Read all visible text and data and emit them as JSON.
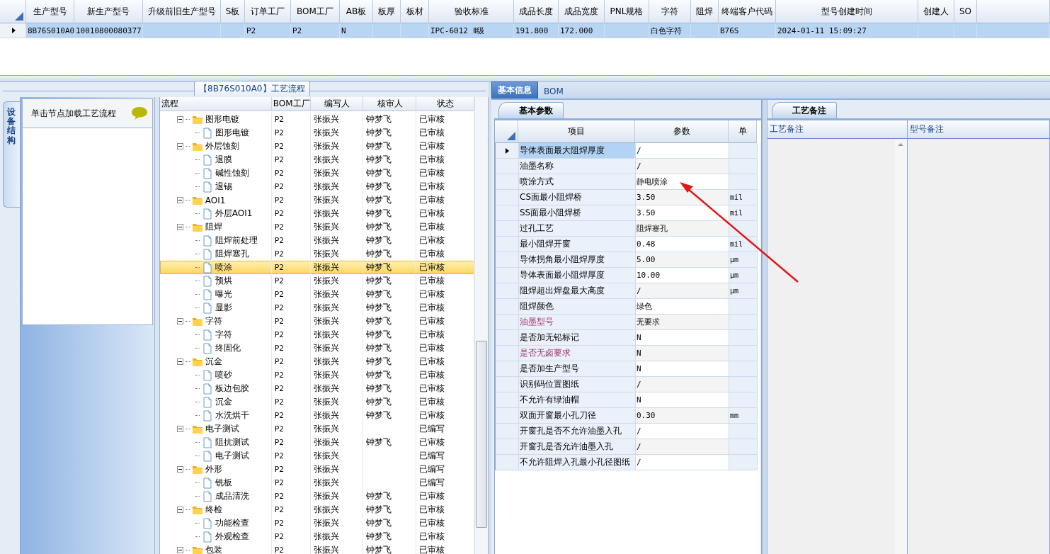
{
  "top_grid": {
    "columns": [
      "生产型号",
      "新生产型号",
      "升级前旧生产型号",
      "S板",
      "订单工厂",
      "BOM工厂",
      "AB板",
      "板厚",
      "板材",
      "验收标准",
      "成品长度",
      "成品宽度",
      "PNL规格",
      "字符",
      "阻焊",
      "终端客户代码",
      "型号创建时间",
      "创建人",
      "SO"
    ],
    "rows": [
      {
        "selected": true,
        "cells": [
          "8B76S010A0",
          "10010800080377",
          null,
          null,
          "P2",
          "P2",
          "N",
          null,
          null,
          "IPC-6012 Ⅱ级",
          "191.800",
          "172.000",
          null,
          "白色字符",
          null,
          "B76S",
          "2024-01-11 15:09:27",
          null,
          null
        ]
      }
    ]
  },
  "side_tab": {
    "label": "设备结构",
    "selected": true
  },
  "equipment_panel": {
    "hint": "单击节点加载工艺流程"
  },
  "process_group": {
    "title": "【8B76S010A0】工艺流程",
    "columns": [
      "流程",
      "BOM工厂",
      "编写人",
      "核审人",
      "状态"
    ],
    "tree": [
      {
        "name": "图形电镀",
        "factory": "P2",
        "writer": "张振兴",
        "reviewer": "钟梦飞",
        "status": "已审核",
        "selected": false,
        "expanded": true,
        "children": [
          {
            "name": "图形电镀",
            "factory": "P2",
            "writer": "张振兴",
            "reviewer": "钟梦飞",
            "status": "已审核",
            "selected": false
          }
        ]
      },
      {
        "name": "外层蚀刻",
        "factory": "P2",
        "writer": "张振兴",
        "reviewer": "钟梦飞",
        "status": "已审核",
        "selected": false,
        "expanded": true,
        "children": [
          {
            "name": "退膜",
            "factory": "P2",
            "writer": "张振兴",
            "reviewer": "钟梦飞",
            "status": "已审核",
            "selected": false
          },
          {
            "name": "碱性蚀刻",
            "factory": "P2",
            "writer": "张振兴",
            "reviewer": "钟梦飞",
            "status": "已审核",
            "selected": false
          },
          {
            "name": "退锡",
            "factory": "P2",
            "writer": "张振兴",
            "reviewer": "钟梦飞",
            "status": "已审核",
            "selected": false
          }
        ]
      },
      {
        "name": "AOI1",
        "factory": "P2",
        "writer": "张振兴",
        "reviewer": "钟梦飞",
        "status": "已审核",
        "selected": false,
        "expanded": true,
        "children": [
          {
            "name": "外层AOI1",
            "factory": "P2",
            "writer": "张振兴",
            "reviewer": "钟梦飞",
            "status": "已审核",
            "selected": false
          }
        ]
      },
      {
        "name": "阻焊",
        "factory": "P2",
        "writer": "张振兴",
        "reviewer": "钟梦飞",
        "status": "已审核",
        "selected": false,
        "expanded": true,
        "children": [
          {
            "name": "阻焊前处理",
            "factory": "P2",
            "writer": "张振兴",
            "reviewer": "钟梦飞",
            "status": "已审核",
            "selected": false
          },
          {
            "name": "阻焊塞孔",
            "factory": "P2",
            "writer": "张振兴",
            "reviewer": "钟梦飞",
            "status": "已审核",
            "selected": false
          },
          {
            "name": "喷涂",
            "factory": "P2",
            "writer": "张振兴",
            "reviewer": "钟梦飞",
            "status": "已审核",
            "selected": true
          },
          {
            "name": "预烘",
            "factory": "P2",
            "writer": "张振兴",
            "reviewer": "钟梦飞",
            "status": "已审核",
            "selected": false
          },
          {
            "name": "曝光",
            "factory": "P2",
            "writer": "张振兴",
            "reviewer": "钟梦飞",
            "status": "已审核",
            "selected": false
          },
          {
            "name": "显影",
            "factory": "P2",
            "writer": "张振兴",
            "reviewer": "钟梦飞",
            "status": "已审核",
            "selected": false
          }
        ]
      },
      {
        "name": "字符",
        "factory": "P2",
        "writer": "张振兴",
        "reviewer": "钟梦飞",
        "status": "已审核",
        "selected": false,
        "expanded": true,
        "children": [
          {
            "name": "字符",
            "factory": "P2",
            "writer": "张振兴",
            "reviewer": "钟梦飞",
            "status": "已审核",
            "selected": false
          },
          {
            "name": "终固化",
            "factory": "P2",
            "writer": "张振兴",
            "reviewer": "钟梦飞",
            "status": "已审核",
            "selected": false
          }
        ]
      },
      {
        "name": "沉金",
        "factory": "P2",
        "writer": "张振兴",
        "reviewer": "钟梦飞",
        "status": "已审核",
        "selected": false,
        "expanded": true,
        "children": [
          {
            "name": "喷砂",
            "factory": "P2",
            "writer": "张振兴",
            "reviewer": "钟梦飞",
            "status": "已审核",
            "selected": false
          },
          {
            "name": "板边包胶",
            "factory": "P2",
            "writer": "张振兴",
            "reviewer": "钟梦飞",
            "status": "已审核",
            "selected": false
          },
          {
            "name": "沉金",
            "factory": "P2",
            "writer": "张振兴",
            "reviewer": "钟梦飞",
            "status": "已审核",
            "selected": false
          },
          {
            "name": "水洗烘干",
            "factory": "P2",
            "writer": "张振兴",
            "reviewer": "钟梦飞",
            "status": "已审核",
            "selected": false
          }
        ]
      },
      {
        "name": "电子测试",
        "factory": "P2",
        "writer": "张振兴",
        "status": "已编写",
        "selected": false,
        "expanded": true,
        "children": [
          {
            "name": "阻抗测试",
            "factory": "P2",
            "writer": "张振兴",
            "reviewer": "钟梦飞",
            "status": "已审核",
            "selected": false
          },
          {
            "name": "电子测试",
            "factory": "P2",
            "writer": "张振兴",
            "status": "已编写",
            "selected": false
          }
        ]
      },
      {
        "name": "外形",
        "factory": "P2",
        "writer": "张振兴",
        "status": "已编写",
        "selected": false,
        "expanded": true,
        "children": [
          {
            "name": "铣板",
            "factory": "P2",
            "writer": "张振兴",
            "status": "已编写",
            "selected": false
          },
          {
            "name": "成品清洗",
            "factory": "P2",
            "writer": "张振兴",
            "reviewer": "钟梦飞",
            "status": "已审核",
            "selected": false
          }
        ]
      },
      {
        "name": "终检",
        "factory": "P2",
        "writer": "张振兴",
        "reviewer": "钟梦飞",
        "status": "已审核",
        "selected": false,
        "expanded": true,
        "children": [
          {
            "name": "功能检查",
            "factory": "P2",
            "writer": "张振兴",
            "reviewer": "钟梦飞",
            "status": "已审核",
            "selected": false
          },
          {
            "name": "外观检查",
            "factory": "P2",
            "writer": "张振兴",
            "reviewer": "钟梦飞",
            "status": "已审核",
            "selected": false
          }
        ]
      },
      {
        "name": "包装",
        "factory": "P2",
        "writer": "张振兴",
        "reviewer": "钟梦飞",
        "status": "已审核",
        "selected": false,
        "expanded": true
      }
    ]
  },
  "detail_tabs": [
    {
      "label": "基本信息",
      "selected": true
    },
    {
      "label": "BOM",
      "selected": false
    }
  ],
  "param_tab": {
    "label": "基本参数",
    "selected": true
  },
  "param_grid": {
    "columns": [
      "项目",
      "参数",
      "单"
    ],
    "rows": [
      {
        "item": "导体表面最大阻焊厚度",
        "value": "/",
        "selected": true,
        "flagged": false
      },
      {
        "item": "油墨名称",
        "value": "/",
        "selected": false,
        "flagged": false
      },
      {
        "item": "喷涂方式",
        "value": "静电喷涂",
        "selected": false,
        "flagged": false
      },
      {
        "item": "CS面最小阻焊桥",
        "value": "3.50",
        "unit": "mil",
        "selected": false,
        "flagged": false
      },
      {
        "item": "SS面最小阻焊桥",
        "value": "3.50",
        "unit": "mil",
        "selected": false,
        "flagged": false
      },
      {
        "item": "过孔工艺",
        "value": "阻焊塞孔",
        "selected": false,
        "flagged": false
      },
      {
        "item": "最小阻焊开窗",
        "value": "0.48",
        "unit": "mil",
        "selected": false,
        "flagged": false
      },
      {
        "item": "导体拐角最小阻焊厚度",
        "value": "5.00",
        "unit": "μm",
        "selected": false,
        "flagged": false
      },
      {
        "item": "导体表面最小阻焊厚度",
        "value": "10.00",
        "unit": "μm",
        "selected": false,
        "flagged": false
      },
      {
        "item": "阻焊超出焊盘最大高度",
        "value": "/",
        "unit": "μm",
        "selected": false,
        "flagged": false
      },
      {
        "item": "阻焊颜色",
        "value": "绿色",
        "selected": false,
        "flagged": false
      },
      {
        "item": "油墨型号",
        "value": "无要求",
        "selected": false,
        "flagged": true
      },
      {
        "item": "是否加无铅标记",
        "value": "N",
        "selected": false,
        "flagged": false
      },
      {
        "item": "是否无卤要求",
        "value": "N",
        "selected": false,
        "flagged": true
      },
      {
        "item": "是否加生产型号",
        "value": "N",
        "selected": false,
        "flagged": false
      },
      {
        "item": "识别码位置图纸",
        "value": "/",
        "selected": false,
        "flagged": false
      },
      {
        "item": "不允许有绿油帽",
        "value": "N",
        "selected": false,
        "flagged": false
      },
      {
        "item": "双面开窗最小孔刀径",
        "value": "0.30",
        "unit": "mm",
        "selected": false,
        "flagged": false
      },
      {
        "item": "开窗孔是否不允许油墨入孔",
        "value": "/",
        "selected": false,
        "flagged": false
      },
      {
        "item": "开窗孔是否允许油墨入孔",
        "value": "/",
        "selected": false,
        "flagged": false
      },
      {
        "item": "不允许阻焊入孔最小孔径图纸",
        "value": "/",
        "selected": false,
        "flagged": false
      }
    ]
  },
  "notes_tab": {
    "label": "工艺备注",
    "selected": true
  },
  "notes_grid": {
    "columns": [
      "工艺备注",
      "型号备注"
    ]
  }
}
